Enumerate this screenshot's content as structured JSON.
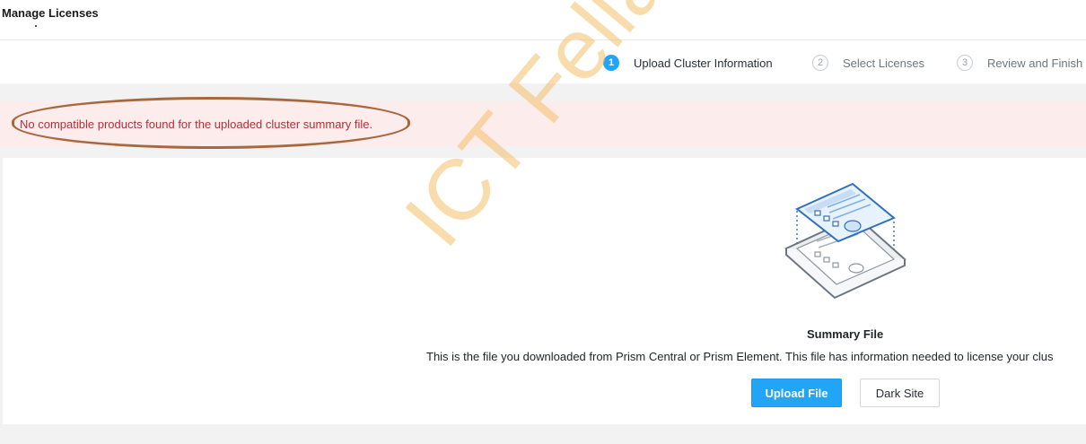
{
  "header": {
    "title": "Manage Licenses"
  },
  "steps": [
    {
      "number": "1",
      "label": "Upload Cluster Information",
      "active": true
    },
    {
      "number": "2",
      "label": "Select Licenses",
      "active": false
    },
    {
      "number": "3",
      "label": "Review and Finish",
      "active": false
    }
  ],
  "alert": {
    "message": "No compatible products found for the uploaded cluster summary file."
  },
  "summary": {
    "title": "Summary File",
    "description": "This is the file you downloaded from Prism Central or Prism Element. This file has information needed to license your clus",
    "illustration_icon": "summary-file-illustration"
  },
  "buttons": {
    "upload_label": "Upload File",
    "dark_site_label": "Dark Site"
  },
  "watermark": {
    "text": "ICT Fella"
  },
  "colors": {
    "accent": "#22a5f7",
    "alert_bg": "#fdecec",
    "alert_text": "#b0303c",
    "annotation_ring": "#a8683f",
    "watermark": "#f5c06a"
  }
}
